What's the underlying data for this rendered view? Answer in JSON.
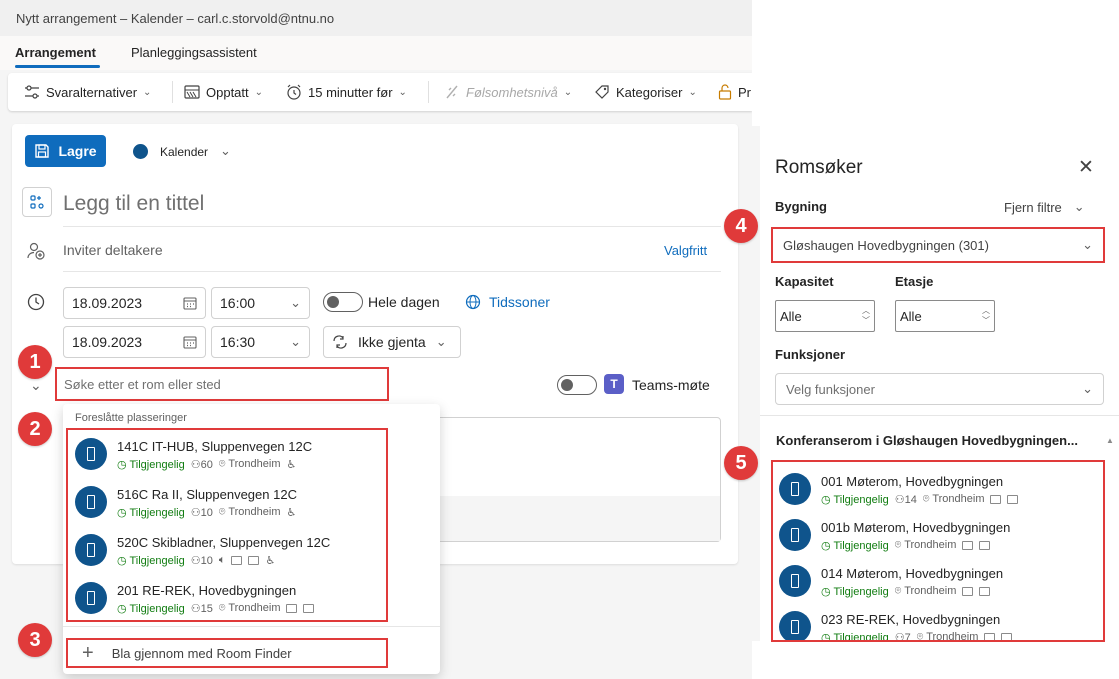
{
  "window": {
    "title": "Nytt arrangement – Kalender – carl.c.storvold@ntnu.no"
  },
  "tabs": [
    "Arrangement",
    "Planleggingsassistent"
  ],
  "toolbar": {
    "response_options": "Svaralternativer",
    "busy": "Opptatt",
    "reminder": "15 minutter før",
    "sensitivity": "Følsomhetsnivå",
    "categorize": "Kategoriser",
    "private_truncated": "Pr"
  },
  "form": {
    "save_label": "Lagre",
    "calendar_label": "Kalender",
    "title_placeholder": "Legg til en tittel",
    "invite_placeholder": "Inviter deltakere",
    "optional_label": "Valgfritt",
    "start_date": "18.09.2023",
    "start_time": "16:00",
    "end_date": "18.09.2023",
    "end_time": "16:30",
    "all_day_label": "Hele dagen",
    "timezones_label": "Tidssoner",
    "repeat_label": "Ikke gjenta",
    "location_placeholder": "Søke etter et rom eller sted",
    "teams_label": "Teams-møte",
    "teams_icon_letter": "T"
  },
  "suggestions": {
    "header": "Foreslåtte plasseringer",
    "rooms": [
      {
        "name": "141C IT-HUB, Sluppenvegen 12C",
        "status": "Tilgjengelig",
        "capacity": "60",
        "city": "Trondheim"
      },
      {
        "name": "516C Ra II, Sluppenvegen 12C",
        "status": "Tilgjengelig",
        "capacity": "10",
        "city": "Trondheim"
      },
      {
        "name": "520C Skibladner, Sluppenvegen 12C",
        "status": "Tilgjengelig",
        "capacity": "10",
        "city": "Trondheim"
      },
      {
        "name": "201 RE-REK, Hovedbygningen",
        "status": "Tilgjengelig",
        "capacity": "15",
        "city": "Trondheim"
      }
    ],
    "browse_label": "Bla gjennom med Room Finder"
  },
  "room_finder": {
    "title": "Romsøker",
    "building_label": "Bygning",
    "clear_filters": "Fjern filtre",
    "building_value": "Gløshaugen Hovedbygningen (301)",
    "capacity_label": "Kapasitet",
    "capacity_value": "Alle",
    "floor_label": "Etasje",
    "floor_value": "Alle",
    "features_label": "Funksjoner",
    "features_placeholder": "Velg funksjoner",
    "results_heading": "Konferanserom i Gløshaugen Hovedbygningen...",
    "rooms": [
      {
        "name": "001 Møterom, Hovedbygningen",
        "status": "Tilgjengelig",
        "capacity": "14",
        "city": "Trondheim"
      },
      {
        "name": "001b Møterom, Hovedbygningen",
        "status": "Tilgjengelig",
        "capacity": "",
        "city": "Trondheim"
      },
      {
        "name": "014 Møterom, Hovedbygningen",
        "status": "Tilgjengelig",
        "capacity": "",
        "city": "Trondheim"
      },
      {
        "name": "023 RE-REK, Hovedbygningen",
        "status": "Tilgjengelig",
        "capacity": "7",
        "city": "Trondheim"
      }
    ]
  },
  "badges": [
    "1",
    "2",
    "3",
    "4",
    "5"
  ],
  "colors": {
    "accent": "#0f6cbd",
    "highlight": "#e03a3a",
    "available": "#107c10",
    "avatar": "#0f548c"
  }
}
